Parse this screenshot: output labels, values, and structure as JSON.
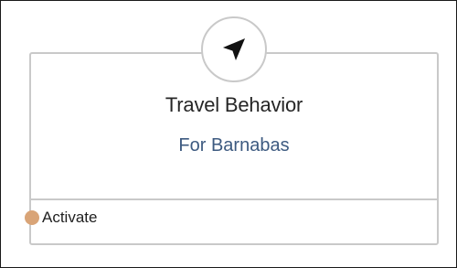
{
  "node": {
    "icon": "navigation-arrow-icon",
    "title": "Travel Behavior",
    "subtitle": "For Barnabas",
    "port": {
      "label": "Activate",
      "color": "#d9a477"
    }
  },
  "colors": {
    "title": "#262626",
    "subtitle": "#3d5a80",
    "border": "#c9c9c9"
  }
}
